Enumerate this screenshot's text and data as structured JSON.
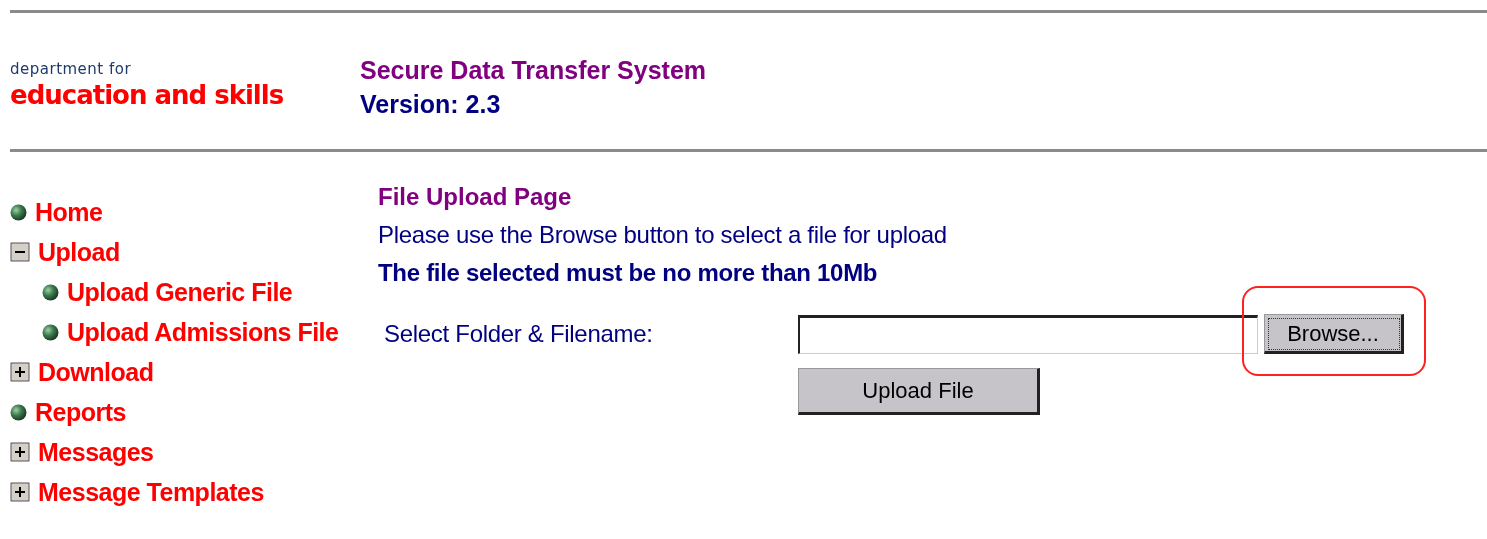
{
  "header": {
    "logo_top": "department for",
    "logo_main": "education and skills",
    "title": "Secure Data Transfer System",
    "version": "Version: 2.3"
  },
  "sidebar": {
    "items": [
      {
        "label": "Home",
        "kind": "bullet"
      },
      {
        "label": "Upload",
        "kind": "toggle",
        "expanded": true,
        "children": [
          {
            "label": "Upload Generic File",
            "kind": "bullet"
          },
          {
            "label": "Upload Admissions File",
            "kind": "bullet"
          }
        ]
      },
      {
        "label": "Download",
        "kind": "toggle",
        "expanded": false
      },
      {
        "label": "Reports",
        "kind": "bullet"
      },
      {
        "label": "Messages",
        "kind": "toggle",
        "expanded": false
      },
      {
        "label": "Message Templates",
        "kind": "toggle",
        "expanded": false
      }
    ]
  },
  "content": {
    "heading": "File Upload Page",
    "instruction": "Please use the Browse button to select a file for upload",
    "warning": "The file selected must be no more than 10Mb",
    "field_label": "Select Folder & Filename:",
    "browse_button": {
      "label": "Browse...",
      "highlighted": true
    },
    "upload_button": "Upload File"
  }
}
